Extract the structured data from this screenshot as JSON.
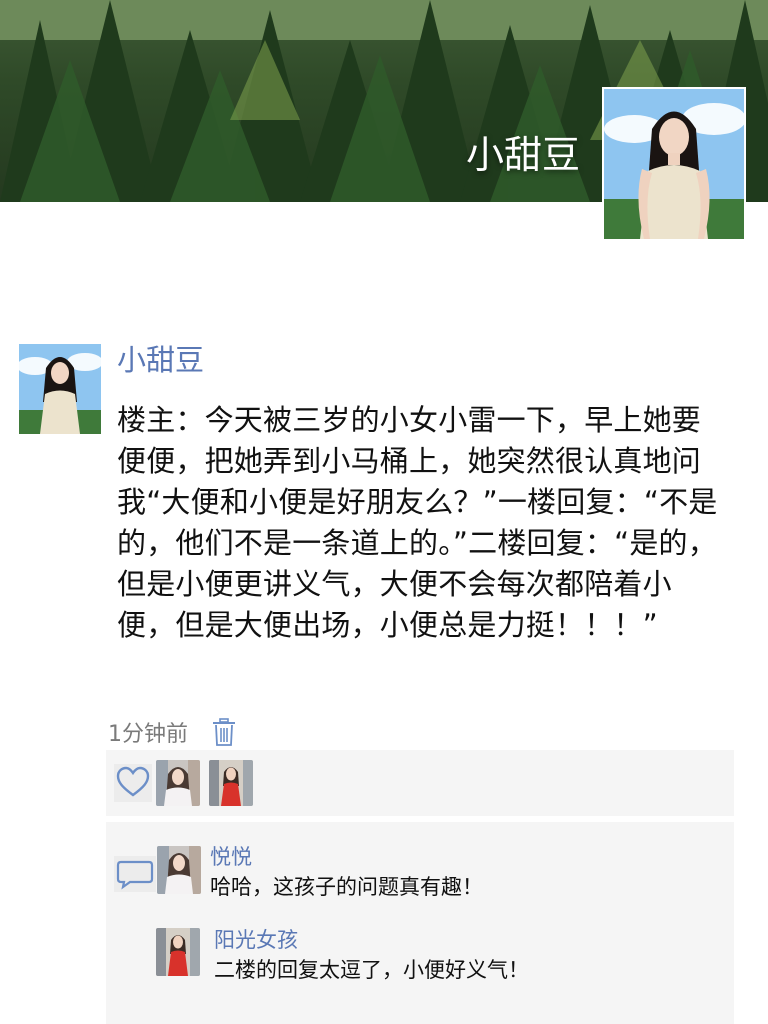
{
  "profile": {
    "name": "小甜豆"
  },
  "post": {
    "author": "小甜豆",
    "content": "楼主：今天被三岁的小女小雷一下，早上她要便便，把她弄到小马桶上，她突然很认真地问我“大便和小便是好朋友么？”一楼回复：“不是的，他们不是一条道上的。”二楼回复：“是的，但是小便更讲义气，大便不会每次都陪着小便，但是大便出场，小便总是力挺！！！”",
    "time": "1分钟前"
  },
  "likes": {
    "icon": "heart-icon",
    "avatars": [
      "like-avatar-1",
      "like-avatar-2"
    ]
  },
  "comments": [
    {
      "name": "悦悦",
      "text": "哈哈，这孩子的问题真有趣！"
    },
    {
      "name": "阳光女孩",
      "text": "二楼的回复太逗了，小便好义气！"
    }
  ],
  "colors": {
    "link": "#5a78b5",
    "panel": "#f5f5f5",
    "icon": "#6c8fc8"
  }
}
